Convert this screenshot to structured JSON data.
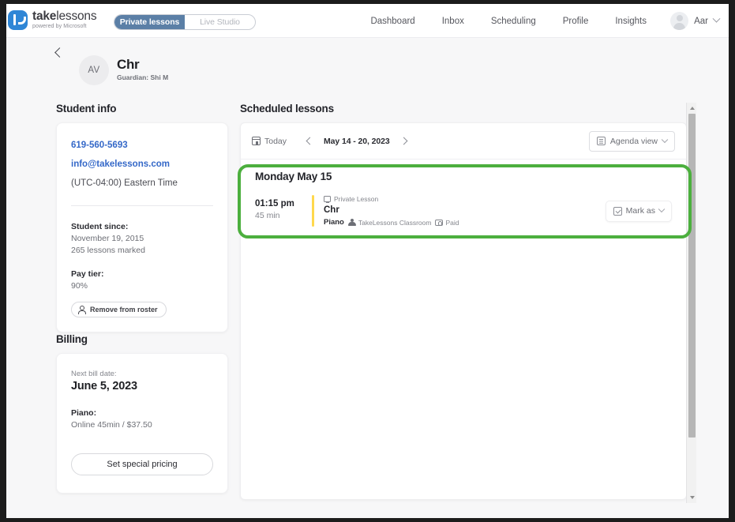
{
  "brand": {
    "name_bold": "take",
    "name_light": "lessons",
    "tagline": "powered by Microsoft",
    "logo_icon": "takelessons-logo-icon",
    "accent_color": "#2f86d6"
  },
  "segmented": {
    "active_label": "Private lessons",
    "inactive_label": "Live Studio",
    "active_color": "#5b7fa6"
  },
  "nav": {
    "links": [
      "Dashboard",
      "Inbox",
      "Scheduling",
      "Profile",
      "Insights"
    ],
    "user_label": "Aar",
    "avatar_icon": "user-avatar-icon",
    "chevron_icon": "chevron-down-icon"
  },
  "student_header": {
    "back_icon": "chevron-left-icon",
    "initials": "AV",
    "name": "Chr",
    "guardian": "Guardian: Shi M"
  },
  "student_info": {
    "title": "Student info",
    "phone": "619-560-5693",
    "email": "info@takelessons.com",
    "timezone": "(UTC-04:00) Eastern Time",
    "since_label": "Student since:",
    "since_date": "November 19, 2015",
    "lessons_marked": "265 lessons marked",
    "pay_tier_label": "Pay tier:",
    "pay_tier_value": "90%",
    "remove_button": "Remove from roster",
    "remove_icon": "person-remove-icon"
  },
  "billing": {
    "title": "Billing",
    "next_bill_label": "Next bill date:",
    "next_bill_date": "June 5, 2023",
    "subject_label": "Piano:",
    "subject_detail": "Online   45min / $37.50",
    "special_pricing_button": "Set special pricing"
  },
  "scheduled": {
    "title": "Scheduled lessons",
    "today_label": "Today",
    "today_icon": "calendar-icon",
    "prev_icon": "chevron-left-icon",
    "next_icon": "chevron-right-icon",
    "date_range": "May 14 - 20, 2023",
    "view_label": "Agenda view",
    "view_icon": "list-view-icon",
    "view_chevron_icon": "chevron-down-icon",
    "day_heading": "Monday May 15",
    "lesson": {
      "time": "01:15 pm",
      "duration": "45 min",
      "type_icon": "monitor-icon",
      "type_label": "Private Lesson",
      "student_name": "Chr",
      "subject": "Piano",
      "classroom_icon": "classroom-icon",
      "classroom_label": "TakeLessons Classroom",
      "paid_icon": "paid-icon",
      "paid_label": "Paid",
      "accent_color": "#ffd84d",
      "mark_as_label": "Mark as",
      "mark_as_icon": "mark-as-icon",
      "mark_as_chevron_icon": "chevron-down-icon"
    }
  },
  "annotation": {
    "highlight_color": "#4caf3e"
  },
  "scrollbar": {
    "up_icon": "scroll-up-arrow-icon",
    "down_icon": "scroll-down-arrow-icon"
  }
}
